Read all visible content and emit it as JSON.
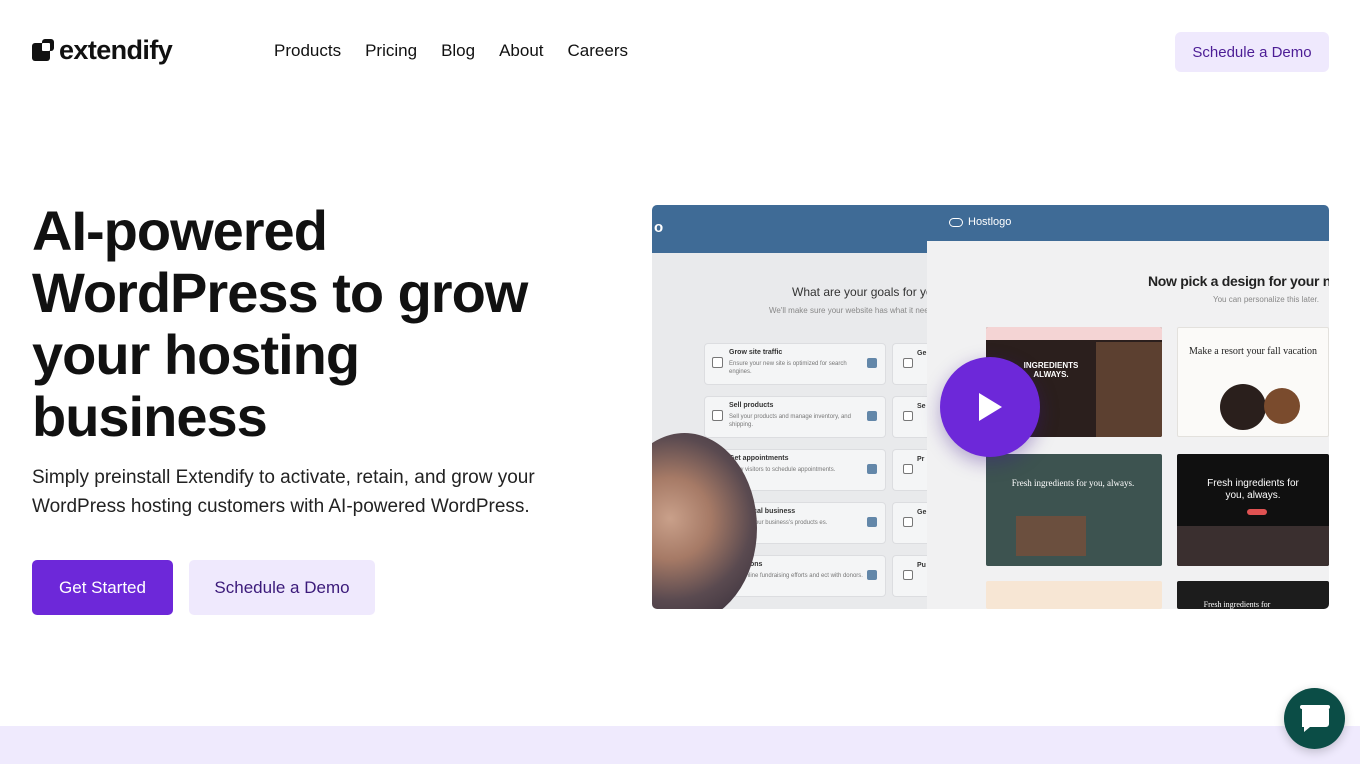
{
  "brand": {
    "name": "extendify"
  },
  "nav": {
    "items": [
      {
        "label": "Products"
      },
      {
        "label": "Pricing"
      },
      {
        "label": "Blog"
      },
      {
        "label": "About"
      },
      {
        "label": "Careers"
      }
    ],
    "cta_label": "Schedule a Demo"
  },
  "hero": {
    "title": "AI-powered WordPress to grow your hosting business",
    "subtitle": "Simply preinstall Extendify to activate, retain, and grow your WordPress hosting customers with AI-powered WordPress.",
    "primary_label": "Get Started",
    "secondary_label": "Schedule a Demo"
  },
  "video": {
    "left_header_fragment": "o",
    "goals_title": "What are your goals for yo",
    "goals_subtitle": "We'll make sure your website has what it need",
    "goals": [
      {
        "title": "Grow site traffic",
        "desc": "Ensure your new site is optimized for search engines."
      },
      {
        "title": "Sell products",
        "desc": "Sell your products and manage inventory, and shipping."
      },
      {
        "title": "Get appointments",
        "desc": "Allow visitors to schedule appointments."
      },
      {
        "title": "a physical business",
        "desc": "traffic to your business's products es."
      },
      {
        "title": "donations",
        "desc": "your online fundraising efforts and ect with donors."
      }
    ],
    "goals_right_fragments": [
      "Ge",
      "Se",
      "Pr",
      "Ge",
      "Pu"
    ],
    "brand_label": "Hostlogo",
    "pick_title": "Now pick a design for your n",
    "pick_subtitle": "You can personalize this later.",
    "templates": [
      {
        "text": "INGREDIENTS ALWAYS."
      },
      {
        "text": "Make a resort your fall vacation"
      },
      {
        "text": "Fresh ingredients for you, always."
      },
      {
        "text": "Fresh ingredients for you, always."
      },
      {
        "text": ""
      },
      {
        "text": "Fresh ingredients for"
      }
    ]
  },
  "colors": {
    "accent": "#6d28d9",
    "accent_soft": "#efe9fd",
    "video_bar": "#3f6b96",
    "chat": "#0b4d46"
  },
  "icons": {
    "logo": "extendify-logo-icon",
    "play": "play-icon",
    "chat": "chat-icon"
  }
}
